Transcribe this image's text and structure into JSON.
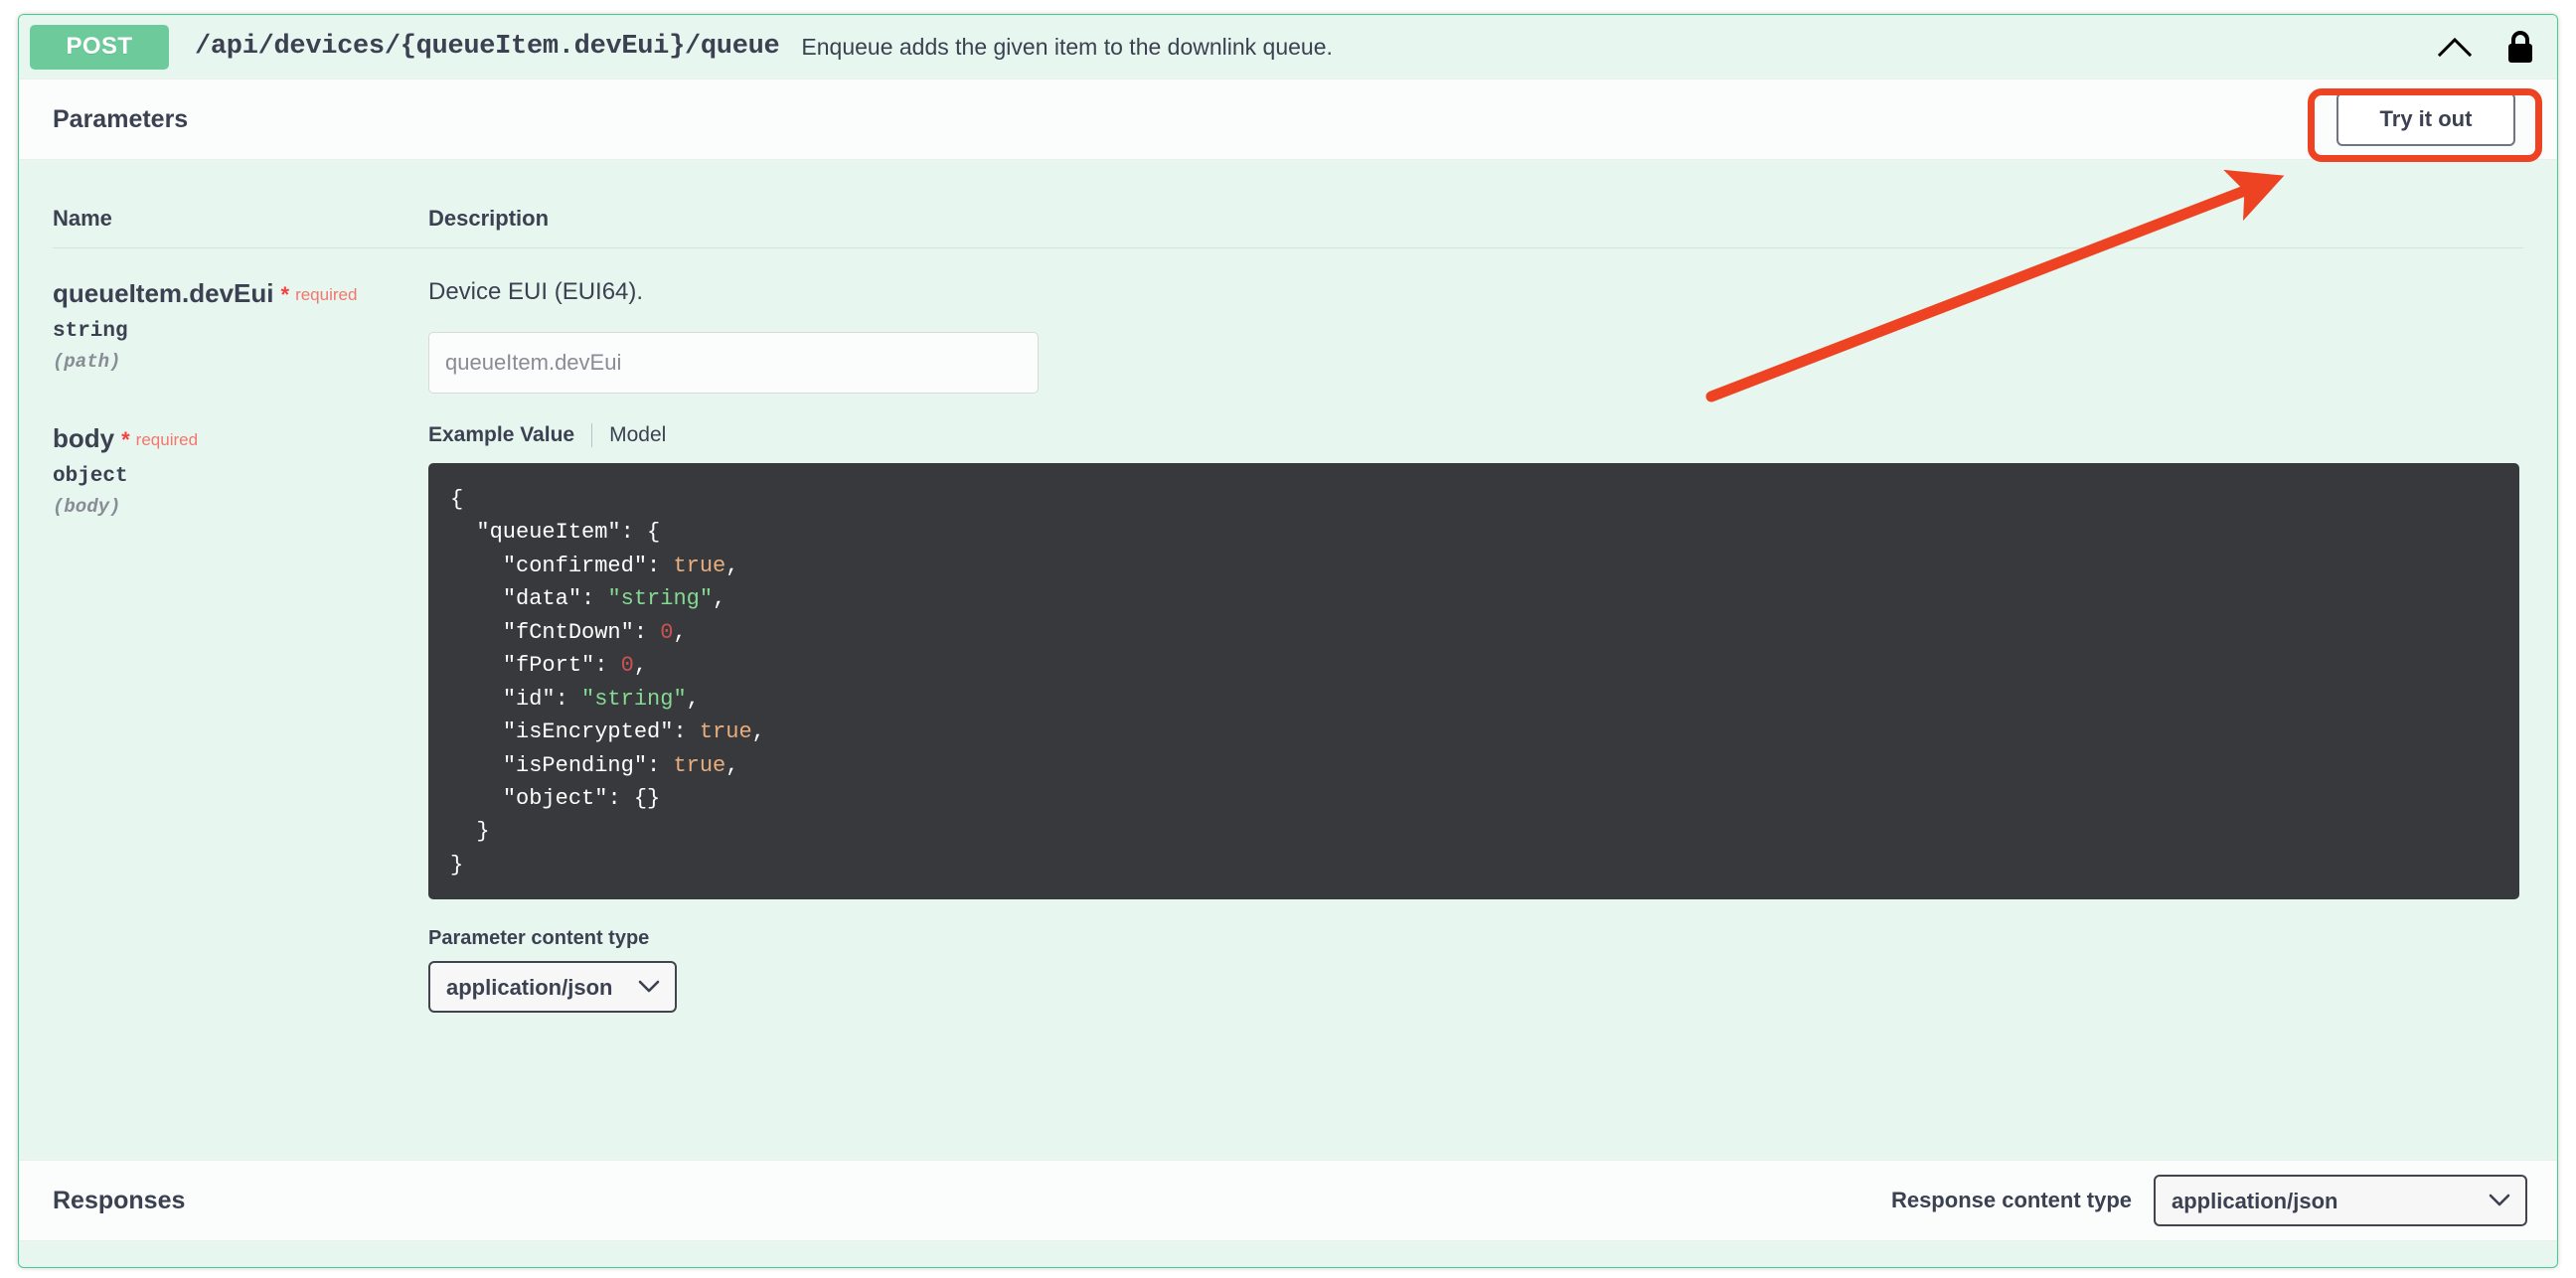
{
  "operation": {
    "method": "POST",
    "path": "/api/devices/{queueItem.devEui}/queue",
    "description": "Enqueue adds the given item to the downlink queue.",
    "collapse_icon": "chevron-up-icon",
    "auth_icon": "lock-icon"
  },
  "parameters_section": {
    "title": "Parameters",
    "try_it_out_label": "Try it out",
    "columns": {
      "name": "Name",
      "description": "Description"
    },
    "rows": [
      {
        "name": "queueItem.devEui",
        "required_star": "*",
        "required_label": "required",
        "type": "string",
        "location": "(path)",
        "description": "Device EUI (EUI64).",
        "input_value": "",
        "input_placeholder": "queueItem.devEui"
      },
      {
        "name": "body",
        "required_star": "*",
        "required_label": "required",
        "type": "object",
        "location": "(body)",
        "tabs": {
          "example_value": "Example Value",
          "model": "Model",
          "active": "Example Value"
        },
        "example_json": {
          "line_01": "{",
          "line_02_key": "\"queueItem\"",
          "line_02_rest": ": {",
          "line_03_key": "\"confirmed\"",
          "line_03_val": "true",
          "line_04_key": "\"data\"",
          "line_04_val": "\"string\"",
          "line_05_key": "\"fCntDown\"",
          "line_05_val": "0",
          "line_06_key": "\"fPort\"",
          "line_06_val": "0",
          "line_07_key": "\"id\"",
          "line_07_val": "\"string\"",
          "line_08_key": "\"isEncrypted\"",
          "line_08_val": "true",
          "line_09_key": "\"isPending\"",
          "line_09_val": "true",
          "line_10_key": "\"object\"",
          "line_10_val": "{}",
          "line_11": "  }",
          "line_12": "}"
        },
        "content_type_label": "Parameter content type",
        "content_type_value": "application/json",
        "content_type_options": [
          "application/json"
        ]
      }
    ]
  },
  "responses_section": {
    "title": "Responses",
    "content_type_label": "Response content type",
    "content_type_value": "application/json",
    "content_type_options": [
      "application/json"
    ]
  },
  "annotations": {
    "highlight_color": "#ee4322",
    "arrow_color": "#ee4322",
    "arrow_from": "1720,398",
    "arrow_to": "2290,178",
    "target": "try-it-out-button"
  },
  "colors": {
    "block_background": "#e8f6f0",
    "block_border": "#49cc90",
    "method_badge": "#6dcb9b",
    "section_bar": "#fbfcfc",
    "code_background": "#37393c",
    "text": "#3b4151",
    "required": "#f93e3e"
  }
}
